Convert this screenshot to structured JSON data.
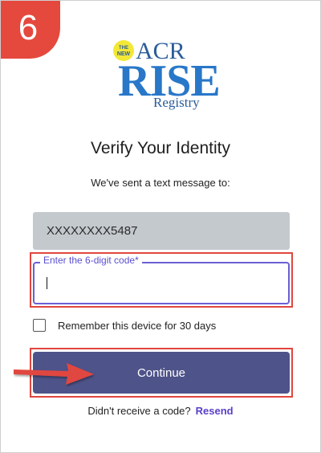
{
  "step": {
    "number": "6",
    "color": "#e5483d"
  },
  "logo": {
    "new_badge": "THE NEW",
    "acr": "ACR",
    "rise": "RISE",
    "registry": "Registry"
  },
  "heading": "Verify Your Identity",
  "subtext": "We've sent a text message to:",
  "phone": {
    "value": "XXXXXXXX5487"
  },
  "code_field": {
    "label": "Enter the 6-digit code*",
    "value": ""
  },
  "remember": {
    "label": "Remember this device for 30 days",
    "checked": false
  },
  "continue_button": {
    "label": "Continue"
  },
  "footer": {
    "question": "Didn't receive a code?",
    "resend_label": "Resend"
  },
  "colors": {
    "accent": "#4e5389",
    "focus": "#6b5fd6",
    "highlight": "#e0463f",
    "link": "#5a3fc8"
  }
}
